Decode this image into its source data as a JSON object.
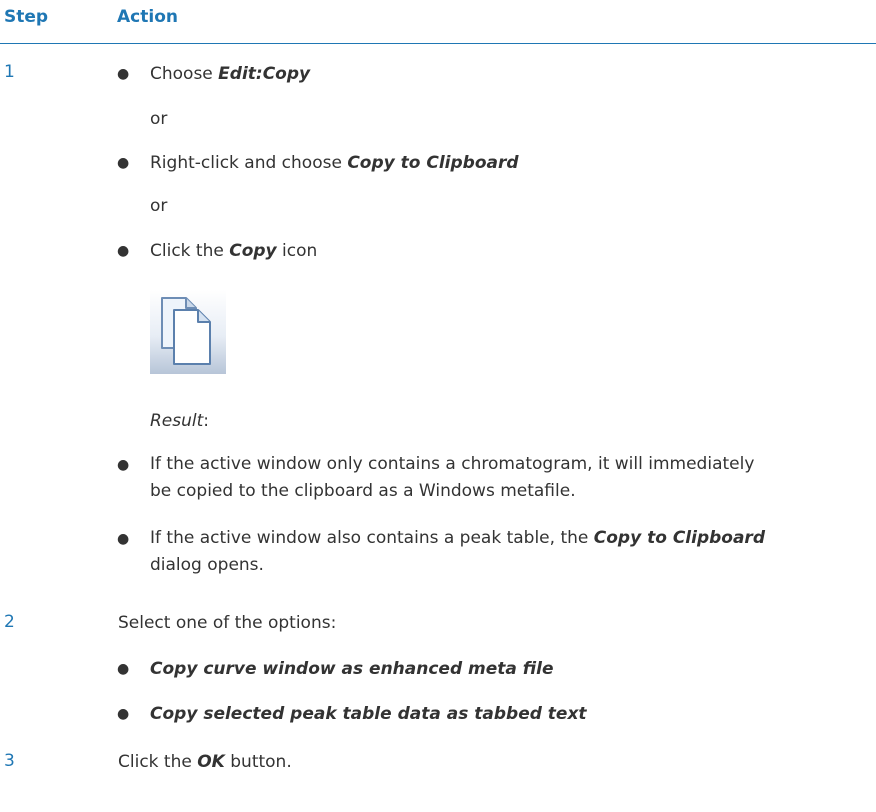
{
  "header": {
    "step": "Step",
    "action": "Action"
  },
  "steps": [
    {
      "number": "1",
      "bullets": [
        {
          "prefix": "Choose ",
          "bold": "Edit:Copy",
          "suffix": ""
        },
        {
          "prefix": "Right-click and choose ",
          "bold": "Copy to Clipboard",
          "suffix": ""
        },
        {
          "prefix": "Click the ",
          "bold": "Copy",
          "suffix": " icon"
        }
      ],
      "or_text": "or",
      "copy_icon": "copy-icon",
      "result_label": "Result",
      "result_colon": ":",
      "result_bullets": [
        {
          "line1": "If the active window only contains a chromatogram, it will immediately",
          "line2": "be copied to the clipboard as a Windows metafile."
        },
        {
          "prefix": "If the active window also contains a peak table, the ",
          "bold": "Copy to Clipboard",
          "line2": "dialog opens."
        }
      ]
    },
    {
      "number": "2",
      "text": "Select one of the options:",
      "options": [
        "Copy curve window as enhanced meta file",
        "Copy selected peak table data as tabbed text"
      ]
    },
    {
      "number": "3",
      "prefix": "Click the ",
      "bold": "OK",
      "suffix": " button."
    }
  ]
}
